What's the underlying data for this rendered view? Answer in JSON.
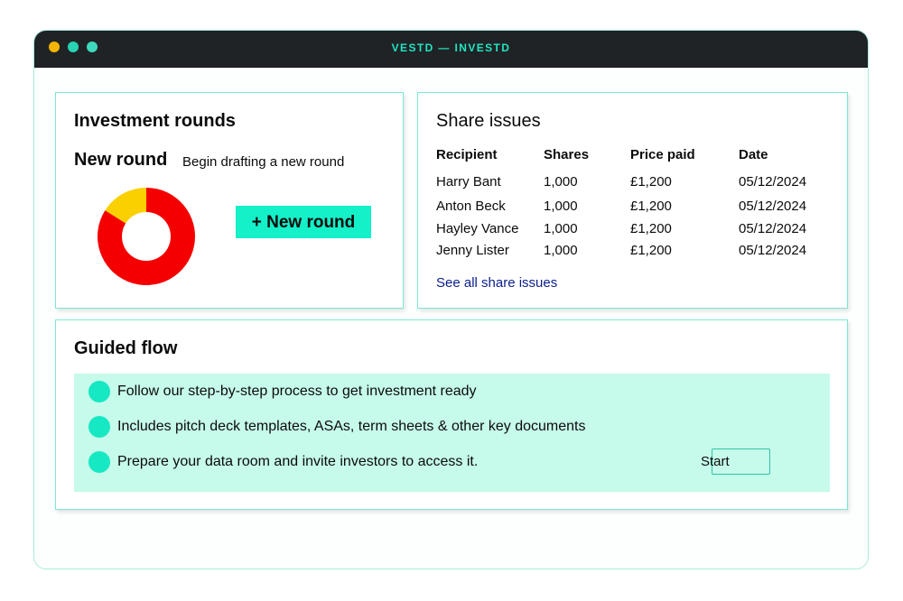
{
  "window": {
    "title": "VESTD — INVESTD"
  },
  "investment_rounds": {
    "title": "Investment rounds",
    "new_round_label": "New round",
    "new_round_subtitle": "Begin drafting a new round",
    "new_round_button": "+ New round",
    "chart_data": {
      "type": "pie",
      "categories": [
        "",
        ""
      ],
      "values": [
        84,
        16
      ],
      "colors": [
        "#f40000",
        "#fbd000"
      ],
      "title": ""
    }
  },
  "share_issues": {
    "title": "Share issues",
    "columns": [
      "Recipient",
      "Shares",
      "Price paid",
      "Date"
    ],
    "rows": [
      [
        "Harry Bant",
        "1,000",
        "£1,200",
        "05/12/2024"
      ],
      [
        "Anton Beck",
        "1,000",
        "£1,200",
        "05/12/2024"
      ],
      [
        "Hayley Vance",
        "1,000",
        "£1,200",
        "05/12/2024"
      ],
      [
        "Jenny Lister",
        "1,000",
        "£1,200",
        "05/12/2024"
      ]
    ],
    "see_all_link": "See all share issues"
  },
  "guided_flow": {
    "title": "Guided flow",
    "items": [
      "Follow our step-by-step process to get investment ready",
      "Includes pitch deck templates, ASAs, term sheets & other key documents",
      "Prepare your data room and invite investors to access it."
    ],
    "start_button": "Start"
  },
  "colors": {
    "accent": "#14f0c8",
    "border": "#79e9d1",
    "panel": "#c6faeb",
    "title_text": "#21e6c1",
    "link": "#0a1f8a"
  }
}
